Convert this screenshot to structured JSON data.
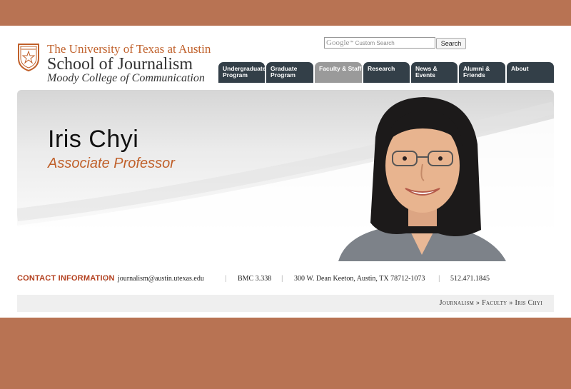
{
  "header": {
    "university": "The University of Texas at Austin",
    "school": "School of Journalism",
    "college": "Moody College of Communication"
  },
  "search": {
    "brand": "Google",
    "placeholder": "Custom Search",
    "button_label": "Search"
  },
  "nav": {
    "tabs": [
      {
        "line1": "Undergraduate",
        "line2": "Program"
      },
      {
        "line1": "Graduate",
        "line2": "Program"
      },
      {
        "line1": "Faculty & Staff",
        "line2": ""
      },
      {
        "line1": "Research",
        "line2": ""
      },
      {
        "line1": "News & Events",
        "line2": ""
      },
      {
        "line1": "Alumni &",
        "line2": "Friends"
      },
      {
        "line1": "About",
        "line2": ""
      }
    ],
    "active_tab": "Faculty & Staff"
  },
  "profile": {
    "name": "Iris Chyi",
    "title": "Associate Professor"
  },
  "contact": {
    "label": "CONTACT INFORMATION",
    "email": "journalism@austin.utexas.edu",
    "office": "BMC 3.338",
    "address": "300 W. Dean Keeton, Austin, TX 78712-1073",
    "phone": "512.471.1845"
  },
  "breadcrumb": {
    "items": [
      "Journalism",
      "Faculty",
      "Iris Chyi"
    ],
    "separator": "»"
  },
  "colors": {
    "frame": "#b87353",
    "brand_orange": "#c0602a",
    "nav_tab": "#333f48",
    "nav_active": "#9a9a9a",
    "contact_label": "#b3401f"
  }
}
